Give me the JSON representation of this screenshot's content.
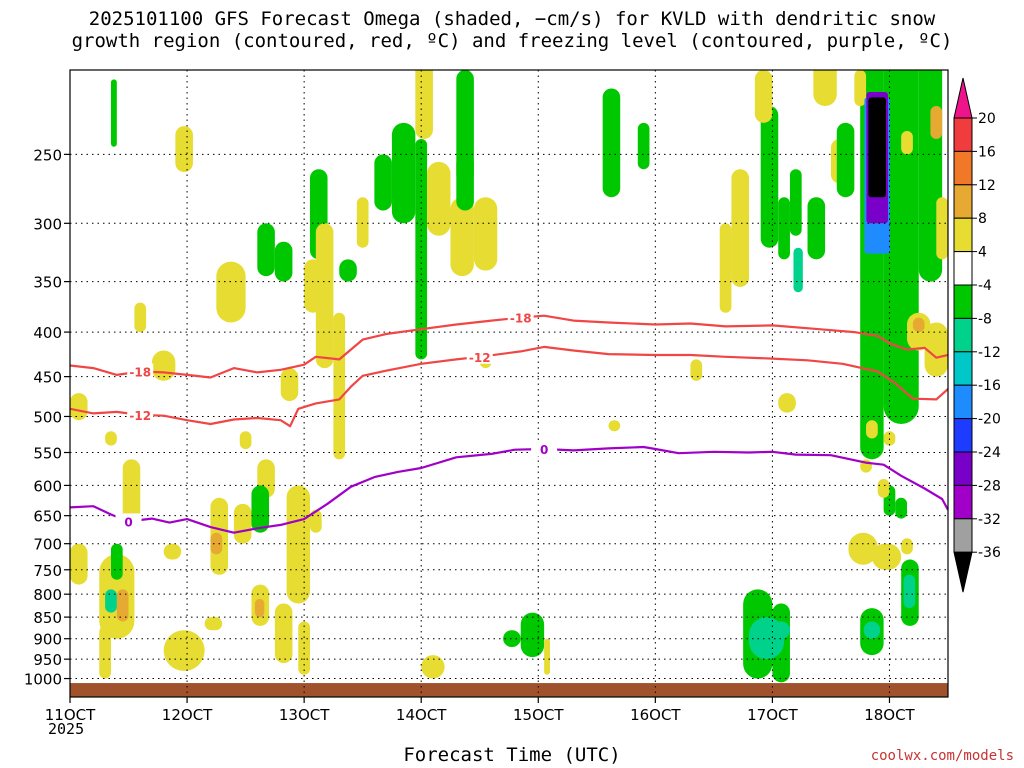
{
  "chart_data": {
    "type": "heatmap",
    "title_line1": "2025101100 GFS Forecast Omega (shaded, −cm/s) for KVLD with dendritic snow",
    "title_line2": "growth region (contoured, red, ºC) and freezing level (contoured, purple, ºC)",
    "xlabel": "Forecast Time (UTC)",
    "year_label": "2025",
    "credit": "coolwx.com/models",
    "x_range_days": [
      11,
      18.5
    ],
    "x_ticks": [
      {
        "day": 11,
        "label": "11OCT"
      },
      {
        "day": 12,
        "label": "12OCT"
      },
      {
        "day": 13,
        "label": "13OCT"
      },
      {
        "day": 14,
        "label": "14OCT"
      },
      {
        "day": 15,
        "label": "15OCT"
      },
      {
        "day": 16,
        "label": "16OCT"
      },
      {
        "day": 17,
        "label": "17OCT"
      },
      {
        "day": 18,
        "label": "18OCT"
      }
    ],
    "y_axis": "pressure (hPa), log scale, reversed",
    "y_range_hpa": [
      1050,
      200
    ],
    "y_ticks": [
      250,
      300,
      350,
      400,
      450,
      500,
      550,
      600,
      650,
      700,
      750,
      800,
      850,
      900,
      950,
      1000
    ],
    "grid": true,
    "colorbar": {
      "labels": [
        "20",
        "16",
        "12",
        "8",
        "4",
        "-4",
        "-8",
        "-12",
        "-16",
        "-20",
        "-24",
        "-28",
        "-32",
        "-36"
      ],
      "colors": [
        "#f0148c",
        "#f03c3c",
        "#f07828",
        "#e6aa32",
        "#e6dc32",
        "#ffffff",
        "#00c800",
        "#00d28c",
        "#00c8c8",
        "#1e8cff",
        "#1e3cff",
        "#7800c8",
        "#a000c8",
        "#a0a0a0",
        "#000000"
      ]
    },
    "series": [
      {
        "label": "-18",
        "color": "#f04646",
        "points": [
          [
            11,
            437
          ],
          [
            11.2,
            440
          ],
          [
            11.4,
            448
          ],
          [
            11.6,
            444
          ],
          [
            11.8,
            445
          ],
          [
            12,
            448
          ],
          [
            12.2,
            451
          ],
          [
            12.4,
            440
          ],
          [
            12.6,
            445
          ],
          [
            12.8,
            442
          ],
          [
            13,
            436
          ],
          [
            13.1,
            427
          ],
          [
            13.3,
            430
          ],
          [
            13.5,
            408
          ],
          [
            13.7,
            402
          ],
          [
            14,
            397
          ],
          [
            14.3,
            392
          ],
          [
            14.6,
            388
          ],
          [
            14.85,
            385
          ],
          [
            15.05,
            383
          ],
          [
            15.3,
            388
          ],
          [
            15.6,
            390
          ],
          [
            16,
            392
          ],
          [
            16.3,
            391
          ],
          [
            16.6,
            394
          ],
          [
            17,
            393
          ],
          [
            17.4,
            397
          ],
          [
            17.7,
            400
          ],
          [
            17.9,
            404
          ],
          [
            18,
            412
          ],
          [
            18.15,
            419
          ],
          [
            18.3,
            417
          ],
          [
            18.4,
            428
          ],
          [
            18.5,
            425
          ]
        ]
      },
      {
        "label": "-12",
        "color": "#f04646",
        "points": [
          [
            11,
            490
          ],
          [
            11.2,
            496
          ],
          [
            11.4,
            494
          ],
          [
            11.6,
            498
          ],
          [
            11.8,
            499
          ],
          [
            12,
            505
          ],
          [
            12.2,
            510
          ],
          [
            12.4,
            504
          ],
          [
            12.6,
            502
          ],
          [
            12.8,
            505
          ],
          [
            12.88,
            513
          ],
          [
            12.95,
            490
          ],
          [
            13.1,
            483
          ],
          [
            13.3,
            478
          ],
          [
            13.4,
            462
          ],
          [
            13.5,
            449
          ],
          [
            13.7,
            443
          ],
          [
            14,
            435
          ],
          [
            14.3,
            430
          ],
          [
            14.5,
            427
          ],
          [
            14.85,
            421
          ],
          [
            15.05,
            416
          ],
          [
            15.3,
            420
          ],
          [
            15.6,
            424
          ],
          [
            16,
            425
          ],
          [
            16.3,
            425
          ],
          [
            16.6,
            427
          ],
          [
            17,
            429
          ],
          [
            17.3,
            431
          ],
          [
            17.6,
            435
          ],
          [
            17.9,
            444
          ],
          [
            18.05,
            458
          ],
          [
            18.2,
            477
          ],
          [
            18.4,
            478
          ],
          [
            18.5,
            465
          ]
        ]
      },
      {
        "label": "0",
        "color": "#a000c8",
        "points": [
          [
            11,
            636
          ],
          [
            11.2,
            634
          ],
          [
            11.35,
            648
          ],
          [
            11.5,
            660
          ],
          [
            11.7,
            655
          ],
          [
            11.85,
            662
          ],
          [
            12,
            656
          ],
          [
            12.2,
            670
          ],
          [
            12.4,
            680
          ],
          [
            12.6,
            672
          ],
          [
            12.8,
            666
          ],
          [
            13,
            656
          ],
          [
            13.2,
            630
          ],
          [
            13.4,
            602
          ],
          [
            13.6,
            587
          ],
          [
            13.8,
            579
          ],
          [
            14,
            573
          ],
          [
            14.3,
            557
          ],
          [
            14.6,
            552
          ],
          [
            14.8,
            546
          ],
          [
            15.05,
            545
          ],
          [
            15.3,
            547
          ],
          [
            15.6,
            544
          ],
          [
            15.9,
            542
          ],
          [
            16,
            545
          ],
          [
            16.2,
            551
          ],
          [
            16.5,
            549
          ],
          [
            16.8,
            550
          ],
          [
            17,
            549
          ],
          [
            17.2,
            553
          ],
          [
            17.5,
            554
          ],
          [
            17.8,
            565
          ],
          [
            17.95,
            568
          ],
          [
            18.1,
            585
          ],
          [
            18.3,
            605
          ],
          [
            18.45,
            622
          ],
          [
            18.5,
            640
          ]
        ]
      }
    ]
  }
}
